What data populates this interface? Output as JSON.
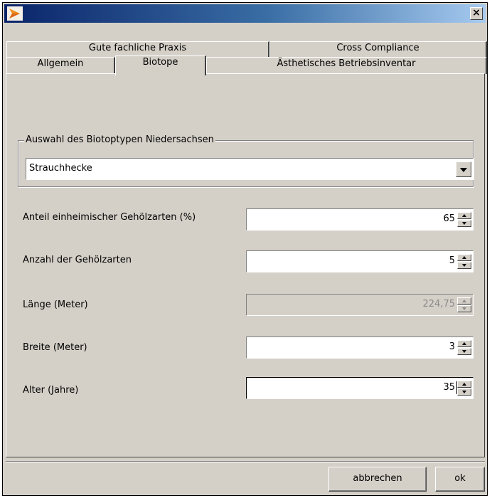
{
  "window": {
    "close_glyph": "×"
  },
  "tabs": {
    "row_back": [
      {
        "label": "Gute fachliche Praxis"
      },
      {
        "label": "Cross Compliance"
      }
    ],
    "row_front": [
      {
        "label": "Allgemein"
      },
      {
        "label": "Biotope"
      },
      {
        "label": "Ästhetisches Betriebsinventar"
      }
    ],
    "active": "Biotope"
  },
  "biotope": {
    "group_title": "Auswahl des Biotoptypen Niedersachsen",
    "selected_type": "Strauchhecke"
  },
  "fields": [
    {
      "label": "Anteil einheimischer Gehölzarten (%)",
      "value": "65",
      "enabled": true
    },
    {
      "label": "Anzahl der Gehölzarten",
      "value": "5",
      "enabled": true
    },
    {
      "label": "Länge (Meter)",
      "value": "224,75",
      "enabled": false
    },
    {
      "label": "Breite (Meter)",
      "value": "3",
      "enabled": true
    },
    {
      "label": "Alter (Jahre)",
      "value": "35",
      "enabled": true,
      "focused": true
    }
  ],
  "buttons": {
    "cancel_label": "abbrechen",
    "ok_label": "ok"
  },
  "colors": {
    "face": "#d4d0c8",
    "title_start": "#0a246a",
    "title_end": "#a6caf0",
    "icon_orange": "#f08c1e"
  }
}
